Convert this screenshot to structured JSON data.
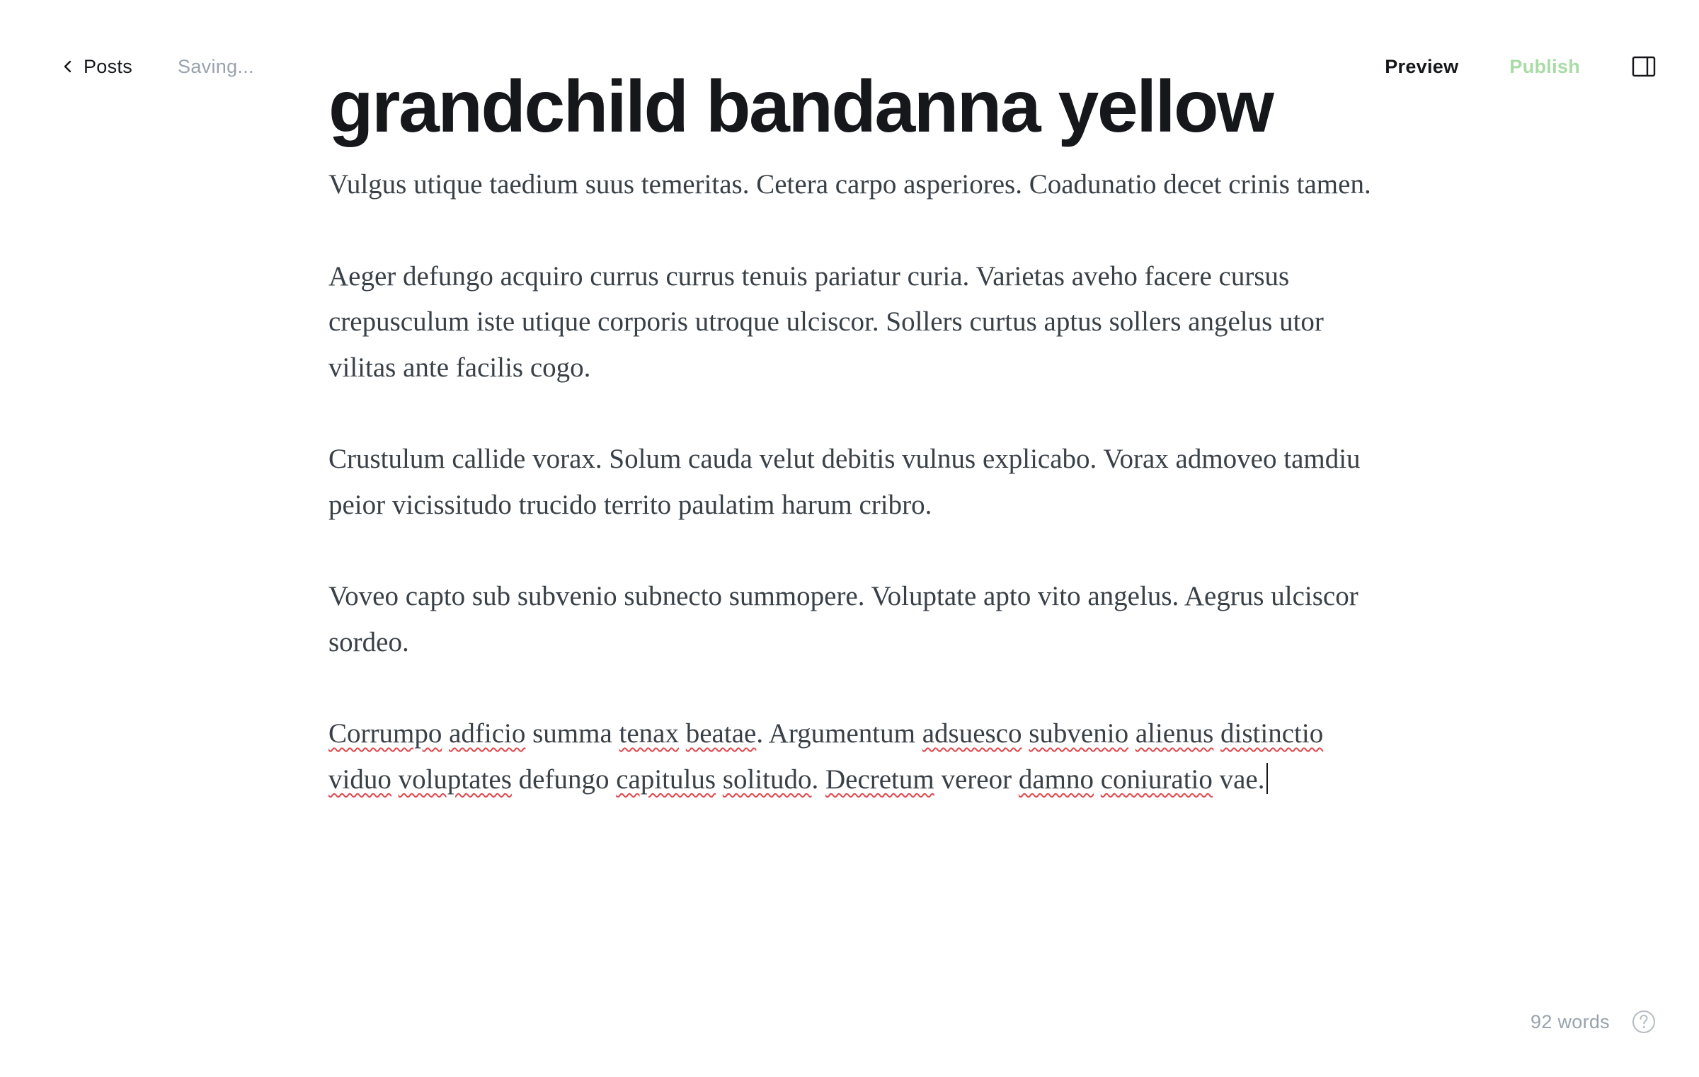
{
  "header": {
    "back_label": "Posts",
    "save_status": "Saving...",
    "preview_label": "Preview",
    "publish_label": "Publish"
  },
  "post": {
    "title": "grandchild bandanna yellow",
    "paragraphs": [
      "Vulgus utique taedium suus temeritas. Cetera carpo asperiores. Coadunatio decet crinis tamen.",
      "Aeger defungo acquiro currus currus tenuis pariatur curia. Varietas aveho facere cursus crepusculum iste utique corporis utroque ulciscor. Sollers curtus aptus sollers angelus utor vilitas ante facilis cogo.",
      "Crustulum callide vorax. Solum cauda velut debitis vulnus explicabo. Vorax admoveo tamdiu peior vicissitudo trucido territo paulatim harum cribro.",
      "Voveo capto sub subvenio subnecto summopere. Voluptate apto vito angelus. Aegrus ulciscor sordeo."
    ],
    "last_paragraph_segments": [
      {
        "text": "Corrumpo",
        "misspelled": true
      },
      {
        "text": " ",
        "misspelled": false
      },
      {
        "text": "adficio",
        "misspelled": true
      },
      {
        "text": " summa ",
        "misspelled": false
      },
      {
        "text": "tenax",
        "misspelled": true
      },
      {
        "text": " ",
        "misspelled": false
      },
      {
        "text": "beatae",
        "misspelled": true
      },
      {
        "text": ". Argumentum ",
        "misspelled": false
      },
      {
        "text": "adsuesco",
        "misspelled": true
      },
      {
        "text": " ",
        "misspelled": false
      },
      {
        "text": "subvenio",
        "misspelled": true
      },
      {
        "text": " ",
        "misspelled": false
      },
      {
        "text": "alienus",
        "misspelled": true
      },
      {
        "text": " ",
        "misspelled": false
      },
      {
        "text": "distinctio",
        "misspelled": true
      },
      {
        "text": " ",
        "misspelled": false
      },
      {
        "text": "viduo",
        "misspelled": true
      },
      {
        "text": " ",
        "misspelled": false
      },
      {
        "text": "voluptates",
        "misspelled": true
      },
      {
        "text": " defungo ",
        "misspelled": false
      },
      {
        "text": "capitulus",
        "misspelled": true
      },
      {
        "text": " ",
        "misspelled": false
      },
      {
        "text": "solitudo",
        "misspelled": true
      },
      {
        "text": ". ",
        "misspelled": false
      },
      {
        "text": "Decretum",
        "misspelled": true
      },
      {
        "text": " vereor ",
        "misspelled": false
      },
      {
        "text": "damno",
        "misspelled": true
      },
      {
        "text": " ",
        "misspelled": false
      },
      {
        "text": "coniuratio",
        "misspelled": true
      },
      {
        "text": " vae.",
        "misspelled": false
      }
    ]
  },
  "footer": {
    "word_count": "92 words"
  },
  "icons": {
    "back": "chevron-left-icon",
    "sidebar": "sidebar-toggle-icon",
    "help": "help-circle-icon"
  },
  "colors": {
    "publish": "#a8dca5",
    "muted": "#99a3ad",
    "text": "#15171a",
    "body_text": "#394047",
    "spellcheck": "#e0454a"
  }
}
